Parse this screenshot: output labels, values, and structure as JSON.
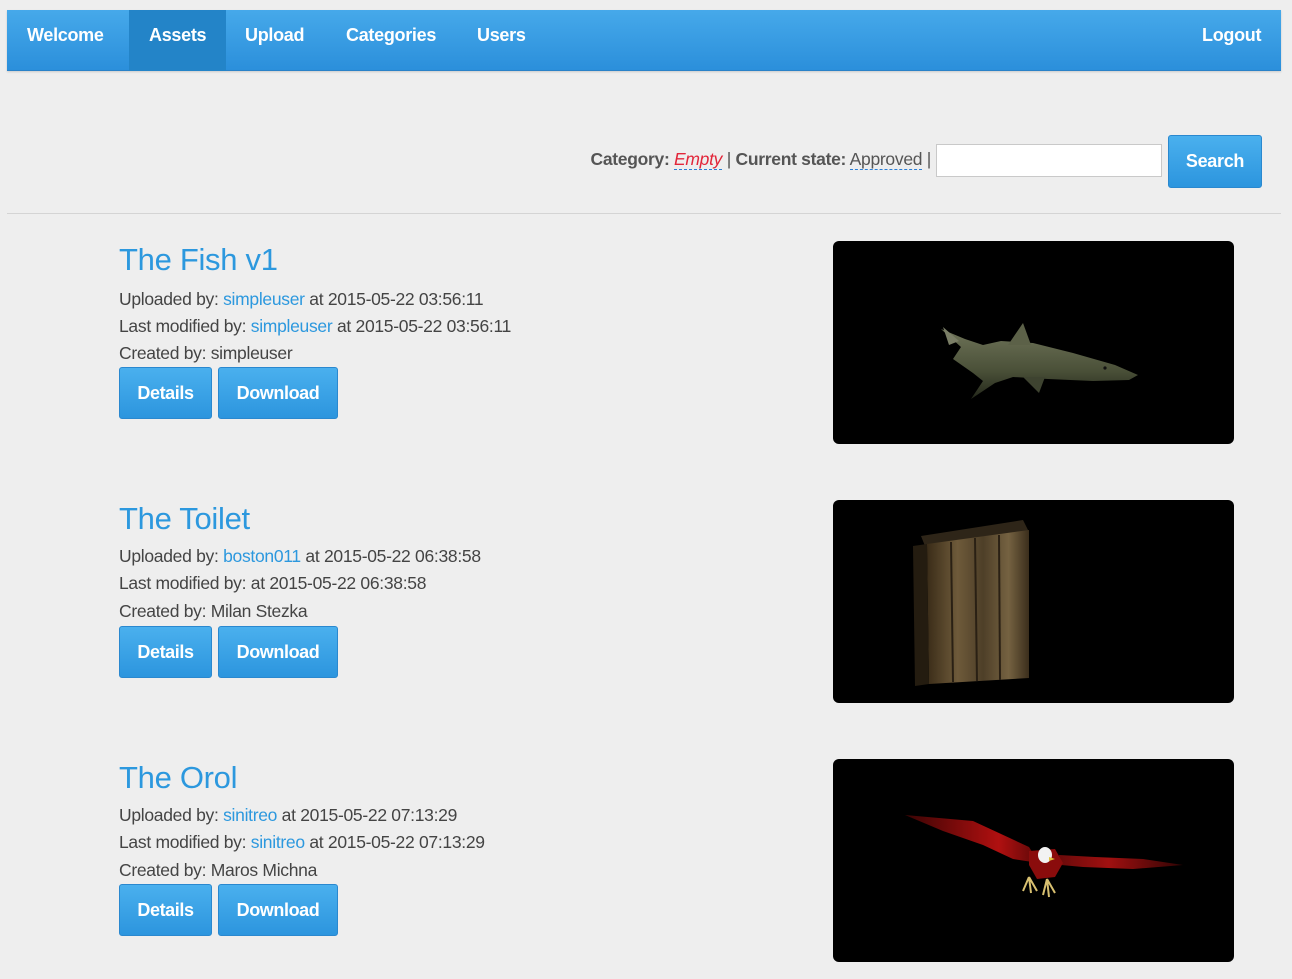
{
  "nav": {
    "items": [
      {
        "label": "Welcome"
      },
      {
        "label": "Assets",
        "active": true
      },
      {
        "label": "Upload"
      },
      {
        "label": "Categories"
      },
      {
        "label": "Users"
      }
    ],
    "logout": "Logout"
  },
  "filter": {
    "category_label": "Category:",
    "category_value": "Empty",
    "separator": "|",
    "state_label": "Current state:",
    "state_value": "Approved",
    "search_value": "",
    "search_button": "Search"
  },
  "assets": [
    {
      "title": "The Fish v1",
      "uploaded_label": "Uploaded by:",
      "uploaded_by": "simpleuser",
      "uploaded_at": "at 2015-05-22 03:56:11",
      "modified_label": "Last modified by:",
      "modified_by": "simpleuser",
      "modified_at": "at 2015-05-22 03:56:11",
      "created_label": "Created by:",
      "created_by": "simpleuser",
      "details": "Details",
      "download": "Download",
      "thumbnail": "shark-model"
    },
    {
      "title": "The Toilet",
      "uploaded_label": "Uploaded by:",
      "uploaded_by": "boston011",
      "uploaded_at": "at 2015-05-22 06:38:58",
      "modified_label": "Last modified by:",
      "modified_by": "",
      "modified_at": "at 2015-05-22 06:38:58",
      "created_label": "Created by:",
      "created_by": "Milan Stezka",
      "details": "Details",
      "download": "Download",
      "thumbnail": "wooden-outhouse-model"
    },
    {
      "title": "The Orol",
      "uploaded_label": "Uploaded by:",
      "uploaded_by": "sinitreo",
      "uploaded_at": "at 2015-05-22 07:13:29",
      "modified_label": "Last modified by:",
      "modified_by": "sinitreo",
      "modified_at": "at 2015-05-22 07:13:29",
      "created_label": "Created by:",
      "created_by": "Maros Michna",
      "details": "Details",
      "download": "Download",
      "thumbnail": "eagle-model"
    }
  ],
  "colors": {
    "accent": "#2c98de",
    "nav_bg": "#3a9fe4",
    "nav_active": "#2384c8",
    "empty_value": "#e2263a",
    "page_bg": "#eeeeee"
  }
}
